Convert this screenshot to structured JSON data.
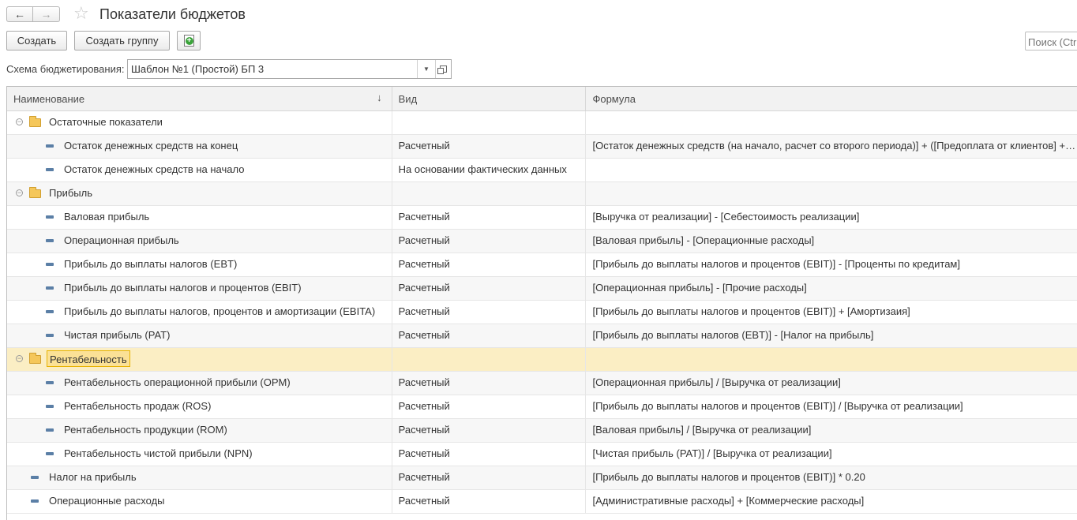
{
  "window": {
    "title": "Показатели бюджетов",
    "back_icon": "←",
    "forward_icon": "→",
    "star_icon": "☆"
  },
  "toolbar": {
    "create_label": "Создать",
    "create_group_label": "Создать группу",
    "copy_icon": "copy-icon",
    "search_placeholder": "Поиск (Ctrl+F)"
  },
  "filter": {
    "label": "Схема бюджетирования:",
    "value": "Шаблон №1 (Простой) БП 3",
    "dropdown_icon": "▼"
  },
  "table": {
    "headers": {
      "name": "Наименование",
      "type": "Вид",
      "formula": "Формула"
    },
    "sort_icon": "↓",
    "rows": [
      {
        "kind": "group",
        "level": 0,
        "name": "Остаточные показатели",
        "type": "",
        "formula": ""
      },
      {
        "kind": "item",
        "level": 1,
        "name": "Остаток денежных средств на конец",
        "type": "Расчетный",
        "formula": "[Остаток денежных средств (на начало, расчет со второго периода)] + ([Предоплата от клиентов] + [Оплата от клиентов]) - ([Оплата поставщикам]...)"
      },
      {
        "kind": "item",
        "level": 1,
        "name": "Остаток денежных средств на начало",
        "type": "На основании фактических данных",
        "formula": ""
      },
      {
        "kind": "group",
        "level": 0,
        "name": "Прибыль",
        "type": "",
        "formula": ""
      },
      {
        "kind": "item",
        "level": 1,
        "name": "Валовая прибыль",
        "type": "Расчетный",
        "formula": "[Выручка от реализации] - [Себестоимость реализации]"
      },
      {
        "kind": "item",
        "level": 1,
        "name": "Операционная прибыль",
        "type": "Расчетный",
        "formula": "[Валовая прибыль] - [Операционные расходы]"
      },
      {
        "kind": "item",
        "level": 1,
        "name": "Прибыль до выплаты налогов (EBT)",
        "type": "Расчетный",
        "formula": "[Прибыль до выплаты налогов и процентов (EBIT)] - [Проценты по кредитам]"
      },
      {
        "kind": "item",
        "level": 1,
        "name": "Прибыль до выплаты налогов и процентов (EBIT)",
        "type": "Расчетный",
        "formula": "[Операционная прибыль] - [Прочие расходы]"
      },
      {
        "kind": "item",
        "level": 1,
        "name": "Прибыль до выплаты налогов, процентов и амортизации (EBITA)",
        "type": "Расчетный",
        "formula": "[Прибыль до выплаты налогов и процентов (EBIT)] + [Амортизаия]"
      },
      {
        "kind": "item",
        "level": 1,
        "name": "Чистая прибыль (PAT)",
        "type": "Расчетный",
        "formula": "[Прибыль до выплаты налогов (EBT)] - [Налог на прибыль]"
      },
      {
        "kind": "group",
        "level": 0,
        "name": "Рентабельность",
        "type": "",
        "formula": "",
        "selected": true
      },
      {
        "kind": "item",
        "level": 1,
        "name": "Рентабельность операционной прибыли (OPM)",
        "type": "Расчетный",
        "formula": "[Операционная прибыль] / [Выручка от реализации]"
      },
      {
        "kind": "item",
        "level": 1,
        "name": "Рентабельность продаж (ROS)",
        "type": "Расчетный",
        "formula": "[Прибыль до выплаты налогов и процентов (EBIT)] / [Выручка от реализации]"
      },
      {
        "kind": "item",
        "level": 1,
        "name": "Рентабельность продукции (ROM)",
        "type": "Расчетный",
        "formula": "[Валовая прибыль] / [Выручка от реализации]"
      },
      {
        "kind": "item",
        "level": 1,
        "name": "Рентабельность чистой прибыли (NPN)",
        "type": "Расчетный",
        "formula": "[Чистая прибыль (PAT)] / [Выручка от реализации]"
      },
      {
        "kind": "item",
        "level": 0,
        "name": "Налог на прибыль",
        "type": "Расчетный",
        "formula": "[Прибыль до выплаты налогов и процентов (EBIT)] * 0.20"
      },
      {
        "kind": "item",
        "level": 0,
        "name": "Операционные расходы",
        "type": "Расчетный",
        "formula": "[Административные расходы] + [Коммерческие расходы]"
      }
    ]
  }
}
